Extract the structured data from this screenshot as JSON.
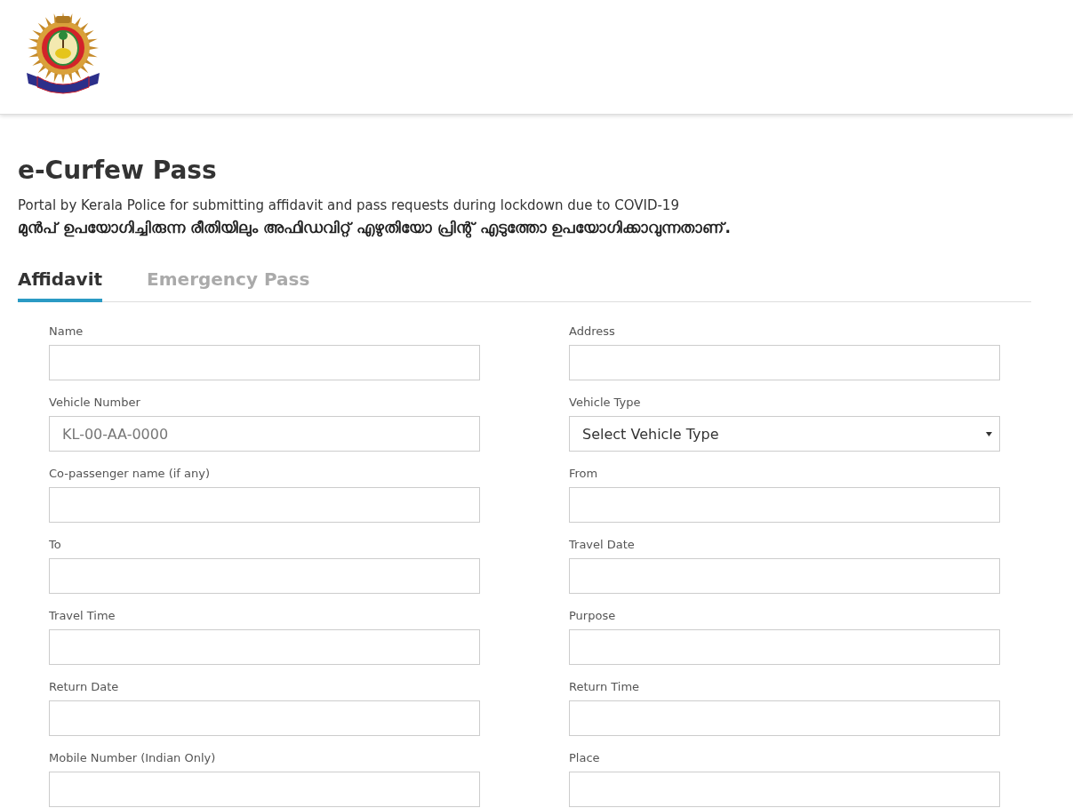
{
  "header": {
    "logo": {
      "kind": "emblem"
    }
  },
  "title": "e-Curfew Pass",
  "subtitle": "Portal by Kerala Police for submitting affidavit and pass requests during lockdown due to COVID-19",
  "notice": "മുൻപ് ഉപയോഗിച്ചിരുന്ന രീതിയിലും അഫിഡവിറ്റ് എഴുതിയോ പ്രിന്റ് എടുത്തോ ഉപയോഗിക്കാവുന്നതാണ്.",
  "tabs": [
    {
      "label": "Affidavit",
      "selected": true
    },
    {
      "label": "Emergency Pass",
      "selected": false
    }
  ],
  "fields": [
    {
      "label": "Name",
      "kind": "text"
    },
    {
      "label": "Address",
      "kind": "text"
    },
    {
      "label": "Vehicle Number",
      "kind": "text",
      "placeholder": "KL-00-AA-0000"
    },
    {
      "label": "Vehicle Type",
      "kind": "select",
      "value": "Select Vehicle Type"
    },
    {
      "label": "Co-passenger name (if any)",
      "kind": "text"
    },
    {
      "label": "From",
      "kind": "text"
    },
    {
      "label": "To",
      "kind": "text"
    },
    {
      "label": "Travel Date",
      "kind": "text"
    },
    {
      "label": "Travel Time",
      "kind": "text"
    },
    {
      "label": "Purpose",
      "kind": "text"
    },
    {
      "label": "Return Date",
      "kind": "text"
    },
    {
      "label": "Return Time",
      "kind": "text"
    },
    {
      "label": "Mobile Number (Indian Only)",
      "kind": "text"
    },
    {
      "label": "Place",
      "kind": "text"
    }
  ]
}
